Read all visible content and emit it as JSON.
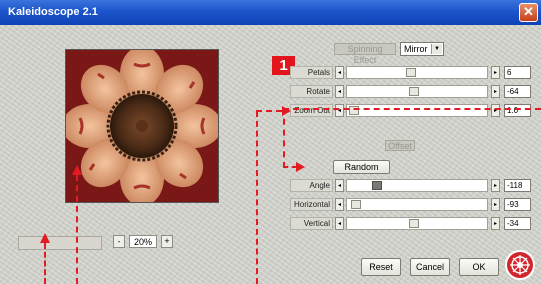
{
  "window": {
    "title": "Kaleidoscope 2.1",
    "close_glyph": "✕"
  },
  "preview": {
    "label": "kaleidoscope-preview-image"
  },
  "zoom": {
    "minus": "-",
    "value": "20%",
    "plus": "+"
  },
  "badge": "1",
  "spinning_effect": {
    "label": "Spinning Effect",
    "selected": "Mirror"
  },
  "sliders_top": [
    {
      "label": "Petals",
      "value": "6",
      "position": 0.42
    },
    {
      "label": "Rotate",
      "value": "-64",
      "position": 0.44
    },
    {
      "label": "Zoom Out",
      "value": "1.0",
      "position": 0.02
    }
  ],
  "offset": {
    "label": "Offset",
    "random_button": "Random"
  },
  "sliders_offset": [
    {
      "label": "Angle",
      "value": "-118",
      "position": 0.24
    },
    {
      "label": "Horizontal",
      "value": "-93",
      "position": 0.02
    },
    {
      "label": "Vertical",
      "value": "-34",
      "position": 0.45
    }
  ],
  "slider_arrows": {
    "left": "◂",
    "right": "▸"
  },
  "buttons": {
    "reset": "Reset",
    "cancel": "Cancel",
    "ok": "OK"
  },
  "colors": {
    "accent": "#e21b22",
    "title_bar": "#1d55cc"
  },
  "icons": {
    "logo": "hubcap-logo-icon",
    "dropdown": "chevron-down-icon"
  }
}
